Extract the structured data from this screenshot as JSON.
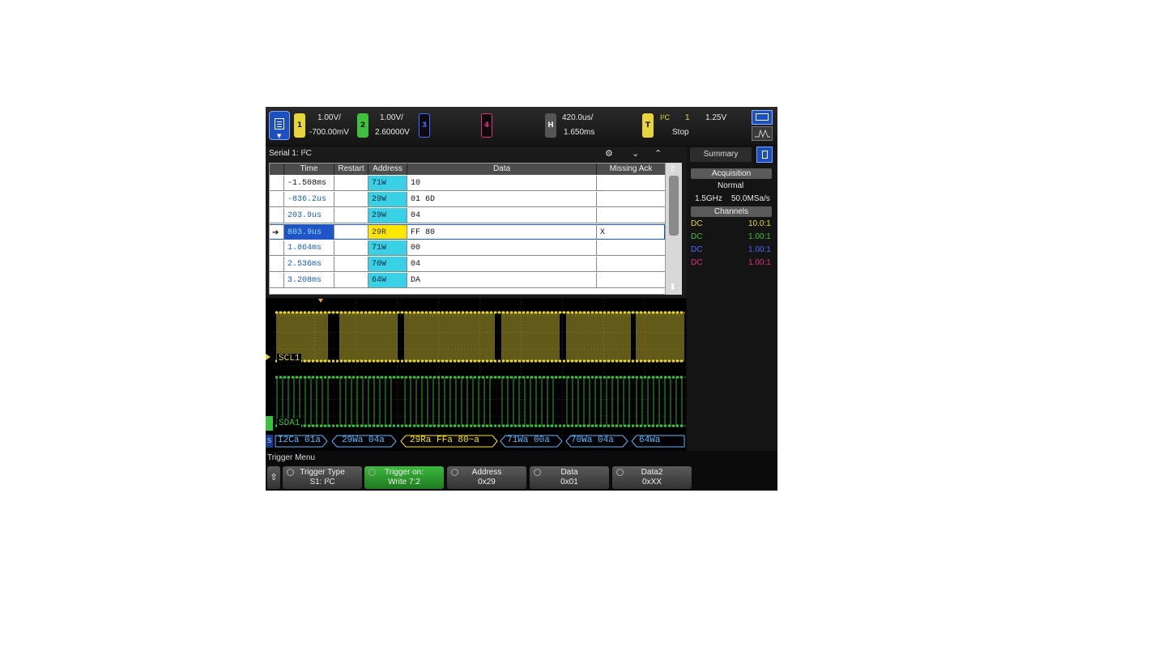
{
  "topbar": {
    "ch1": {
      "num": "1",
      "scale": "1.00V/",
      "offset": "-700.00mV",
      "color": "#e8d53a"
    },
    "ch2": {
      "num": "2",
      "scale": "1.00V/",
      "offset": "2.60000V",
      "color": "#3ec23e"
    },
    "ch3": {
      "num": "3",
      "color": "#4a6bff"
    },
    "ch4": {
      "num": "4",
      "color": "#e0307e"
    },
    "horiz": {
      "label": "H",
      "scale": "420.0us/",
      "delay": "1.650ms"
    },
    "trigger": {
      "label": "T",
      "source": "I²C",
      "channel": "1",
      "level": "1.25V",
      "state": "Stop"
    }
  },
  "list": {
    "title": "Serial 1: I²C",
    "columns": [
      "Time",
      "Restart",
      "Address",
      "Data",
      "Missing Ack"
    ],
    "rows": [
      {
        "time": "-1.508ms",
        "restart": "",
        "address": "71W",
        "data": "10",
        "ack": ""
      },
      {
        "time": "-836.2us",
        "restart": "",
        "address": "29W",
        "data": "01 6D",
        "ack": ""
      },
      {
        "time": "203.9us",
        "restart": "",
        "address": "29W",
        "data": "04",
        "ack": ""
      },
      {
        "time": "803.9us",
        "restart": "",
        "address": "29R",
        "data": "FF 80",
        "ack": "X"
      },
      {
        "time": "1.864ms",
        "restart": "",
        "address": "71W",
        "data": "00",
        "ack": ""
      },
      {
        "time": "2.536ms",
        "restart": "",
        "address": "70W",
        "data": "04",
        "ack": ""
      },
      {
        "time": "3.208ms",
        "restart": "",
        "address": "64W",
        "data": "DA",
        "ack": ""
      }
    ],
    "selected_row": 3
  },
  "summary": {
    "tab": "Summary",
    "acquisition_header": "Acquisition",
    "mode": "Normal",
    "bandwidth": "1.5GHz",
    "sample_rate": "50.0MSa/s",
    "channels_header": "Channels",
    "channels": [
      {
        "coupling": "DC",
        "ratio": "10.0:1",
        "color": "#e8d53a"
      },
      {
        "coupling": "DC",
        "ratio": "1.00:1",
        "color": "#3ec23e"
      },
      {
        "coupling": "DC",
        "ratio": "1.00:1",
        "color": "#4a6bff"
      },
      {
        "coupling": "DC",
        "ratio": "1.00:1",
        "color": "#e0307e"
      }
    ]
  },
  "waveform": {
    "scl_label": "SCL1",
    "sda_label": "SDA1",
    "decode": [
      {
        "text": "I2Ca 01a",
        "color": "#5fb8ff"
      },
      {
        "text": "29Wa 04a",
        "color": "#5fb8ff"
      },
      {
        "text": "29Ra FFa 80~a",
        "color": "#ffe600"
      },
      {
        "text": "71Wa 00a",
        "color": "#5fb8ff"
      },
      {
        "text": "70Wa 04a",
        "color": "#5fb8ff"
      },
      {
        "text": "64Wa",
        "color": "#5fb8ff"
      }
    ]
  },
  "softkeys": {
    "menu_title": "Trigger Menu",
    "keys": [
      {
        "l1": "Trigger Type",
        "l2": "S1: I²C"
      },
      {
        "l1": "Trigger on:",
        "l2": "Write 7:2"
      },
      {
        "l1": "Address",
        "l2": "0x29"
      },
      {
        "l1": "Data",
        "l2": "0x01"
      },
      {
        "l1": "Data2",
        "l2": "0xXX"
      }
    ]
  }
}
